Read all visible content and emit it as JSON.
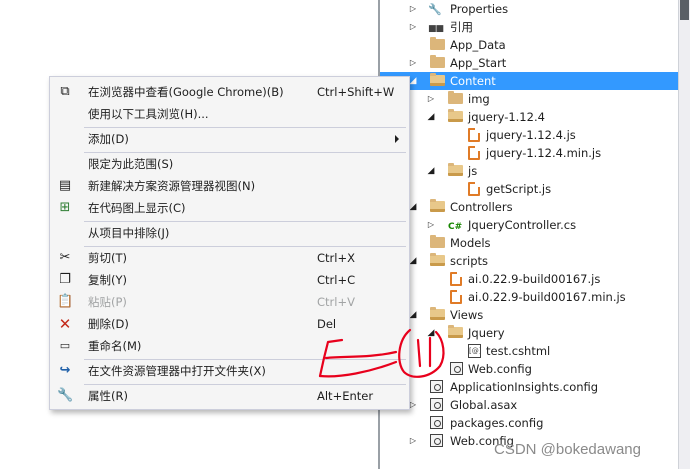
{
  "context_menu": {
    "items": [
      {
        "label": "在浏览器中查看(Google Chrome)(B)",
        "shortcut": "Ctrl+Shift+W",
        "icon": "browser-view-icon",
        "enabled": true
      },
      {
        "label": "使用以下工具浏览(H)...",
        "shortcut": "",
        "icon": "",
        "enabled": true
      },
      {
        "label": "添加(D)",
        "shortcut": "",
        "icon": "",
        "enabled": true,
        "submenu": true
      },
      {
        "label": "限定为此范围(S)",
        "shortcut": "",
        "icon": "",
        "enabled": true
      },
      {
        "label": "新建解决方案资源管理器视图(N)",
        "shortcut": "",
        "icon": "new-view-icon",
        "enabled": true
      },
      {
        "label": "在代码图上显示(C)",
        "shortcut": "",
        "icon": "code-map-icon",
        "enabled": true
      },
      {
        "label": "从项目中排除(J)",
        "shortcut": "",
        "icon": "",
        "enabled": true
      },
      {
        "label": "剪切(T)",
        "shortcut": "Ctrl+X",
        "icon": "scissors-icon",
        "enabled": true
      },
      {
        "label": "复制(Y)",
        "shortcut": "Ctrl+C",
        "icon": "copy-icon",
        "enabled": true
      },
      {
        "label": "粘贴(P)",
        "shortcut": "Ctrl+V",
        "icon": "paste-icon",
        "enabled": false
      },
      {
        "label": "删除(D)",
        "shortcut": "Del",
        "icon": "delete-x-icon",
        "enabled": true
      },
      {
        "label": "重命名(M)",
        "shortcut": "",
        "icon": "rename-icon",
        "enabled": true
      },
      {
        "label": "在文件资源管理器中打开文件夹(X)",
        "shortcut": "",
        "icon": "open-folder-arrow-icon",
        "enabled": true
      },
      {
        "label": "属性(R)",
        "shortcut": "Alt+Enter",
        "icon": "wrench-icon",
        "enabled": true
      }
    ]
  },
  "solution_tree": {
    "items": [
      {
        "label": "Properties",
        "icon": "wrench-icon",
        "toggle": "collapsed"
      },
      {
        "label": "引用",
        "icon": "references-icon",
        "toggle": "collapsed"
      },
      {
        "label": "App_Data",
        "icon": "folder-icon",
        "toggle": "none"
      },
      {
        "label": "App_Start",
        "icon": "folder-icon",
        "toggle": "collapsed"
      },
      {
        "label": "Content",
        "icon": "folder-open-icon",
        "toggle": "expanded",
        "selected": true
      },
      {
        "label": "img",
        "icon": "folder-icon",
        "toggle": "collapsed"
      },
      {
        "label": "jquery-1.12.4",
        "icon": "folder-open-icon",
        "toggle": "expanded"
      },
      {
        "label": "jquery-1.12.4.js",
        "icon": "js-file-icon",
        "toggle": "none"
      },
      {
        "label": "jquery-1.12.4.min.js",
        "icon": "js-file-icon",
        "toggle": "none"
      },
      {
        "label": "js",
        "icon": "folder-open-icon",
        "toggle": "expanded"
      },
      {
        "label": "getScript.js",
        "icon": "js-file-icon",
        "toggle": "none"
      },
      {
        "label": "Controllers",
        "icon": "folder-open-icon",
        "toggle": "expanded"
      },
      {
        "label": "JqueryController.cs",
        "icon": "csharp-file-icon",
        "toggle": "collapsed"
      },
      {
        "label": "Models",
        "icon": "folder-icon",
        "toggle": "none"
      },
      {
        "label": "scripts",
        "icon": "folder-open-icon",
        "toggle": "expanded"
      },
      {
        "label": "ai.0.22.9-build00167.js",
        "icon": "js-file-icon",
        "toggle": "none"
      },
      {
        "label": "ai.0.22.9-build00167.min.js",
        "icon": "js-file-icon",
        "toggle": "none"
      },
      {
        "label": "Views",
        "icon": "folder-open-icon",
        "toggle": "expanded"
      },
      {
        "label": "Jquery",
        "icon": "folder-open-icon",
        "toggle": "expanded"
      },
      {
        "label": "test.cshtml",
        "icon": "razor-file-icon",
        "toggle": "none"
      },
      {
        "label": "Web.config",
        "icon": "config-file-icon",
        "toggle": "none"
      },
      {
        "label": "ApplicationInsights.config",
        "icon": "config-file-icon",
        "toggle": "none"
      },
      {
        "label": "Global.asax",
        "icon": "config-file-icon",
        "toggle": "collapsed"
      },
      {
        "label": "packages.config",
        "icon": "config-file-icon",
        "toggle": "none"
      },
      {
        "label": "Web.config",
        "icon": "config-file-icon",
        "toggle": "collapsed"
      }
    ]
  },
  "watermark": "CSDN @bokedawang",
  "colors": {
    "selection": "#3399ff",
    "js_icon": "#e07b27",
    "folder": "#dcb67a",
    "annotation": "#e8001c",
    "delete_icon": "#c42b1c",
    "open_folder_icon": "#1e5fa8"
  }
}
